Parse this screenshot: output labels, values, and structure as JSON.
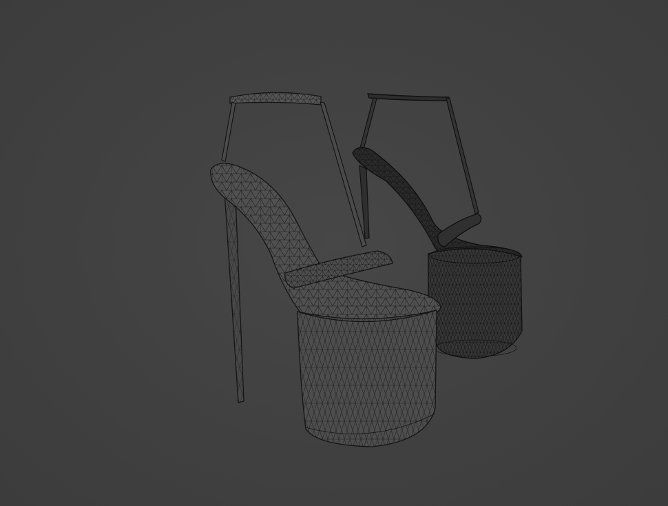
{
  "scene": {
    "background_color": "#3f3f3f",
    "wire_color": "#111111",
    "fill_color": "#4a4a4a",
    "dark_fill_color": "#2e2e2e",
    "object_count": 2,
    "objects": [
      {
        "name": "platform-heel-sandal-front",
        "style": "wireframe"
      },
      {
        "name": "platform-heel-sandal-back",
        "style": "wireframe"
      }
    ]
  }
}
